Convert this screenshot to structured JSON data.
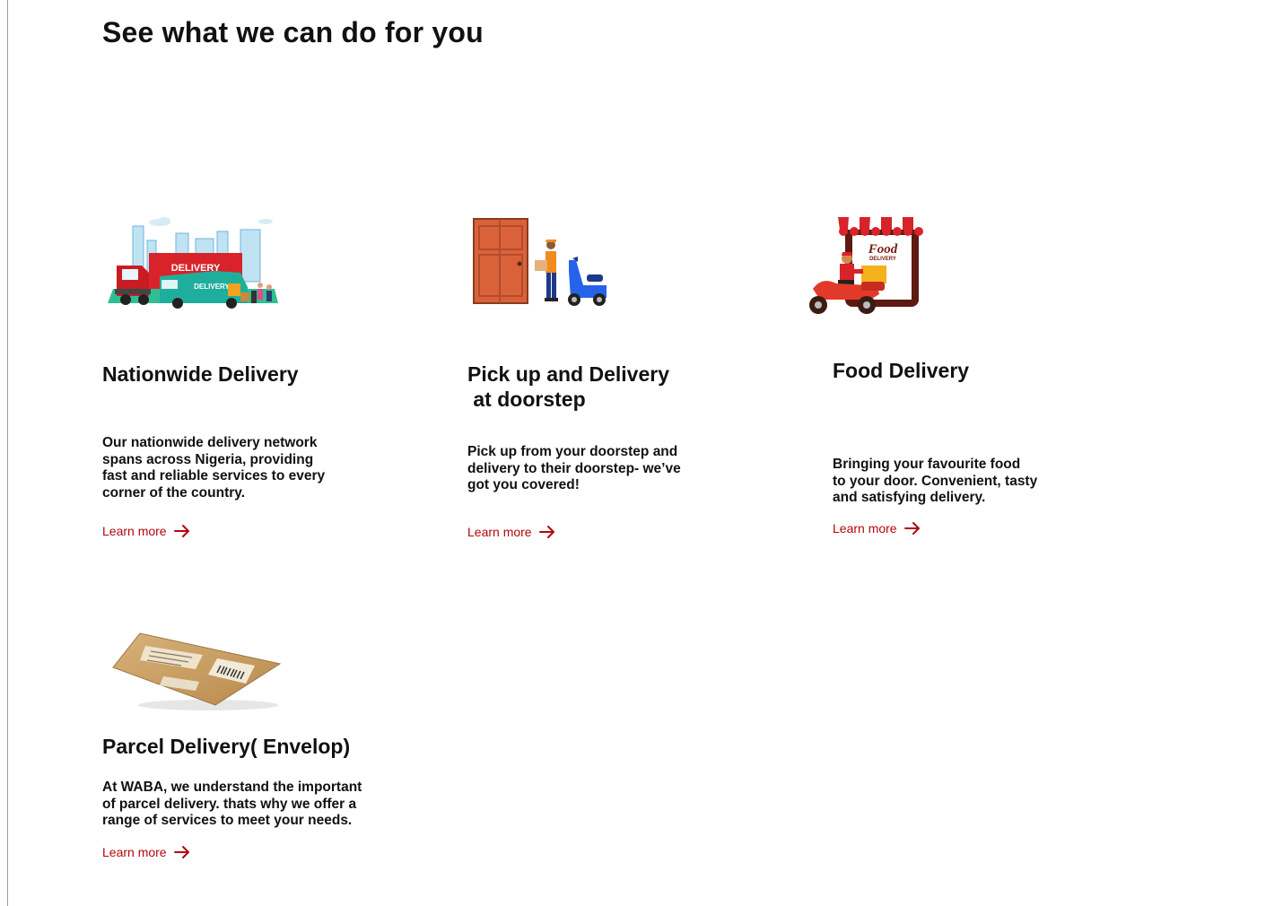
{
  "page": {
    "title": "See what we can do for you",
    "accent_color": "#b3060e"
  },
  "services": [
    {
      "title": "Nationwide Delivery",
      "description": "Our nationwide delivery network\nspans across Nigeria, providing\nfast and reliable services to every\ncorner of the country.",
      "link": "Learn more",
      "illustration": "delivery-trucks-illustration",
      "illustration_text": [
        "DELIVERY",
        "DELIVERY"
      ]
    },
    {
      "title": "Pick up and Delivery\n at doorstep",
      "description": "Pick up from your doorstep and\ndelivery to their doorstep- we’ve\ngot you covered!",
      "link": "Learn more",
      "illustration": "doorstep-courier-illustration"
    },
    {
      "title": "Food Delivery",
      "description": "Bringing your favourite food\nto your door. Convenient, tasty\nand satisfying delivery.",
      "link": "Learn more",
      "illustration": "food-delivery-scooter-illustration",
      "illustration_text": [
        "Food",
        "DELIVERY"
      ]
    },
    {
      "title": "Parcel Delivery( Envelop)",
      "description": "At WABA, we understand the important\nof parcel delivery. thats why we offer a\nrange of services to meet your needs.",
      "link": "Learn more",
      "illustration": "parcel-envelope-illustration"
    }
  ]
}
